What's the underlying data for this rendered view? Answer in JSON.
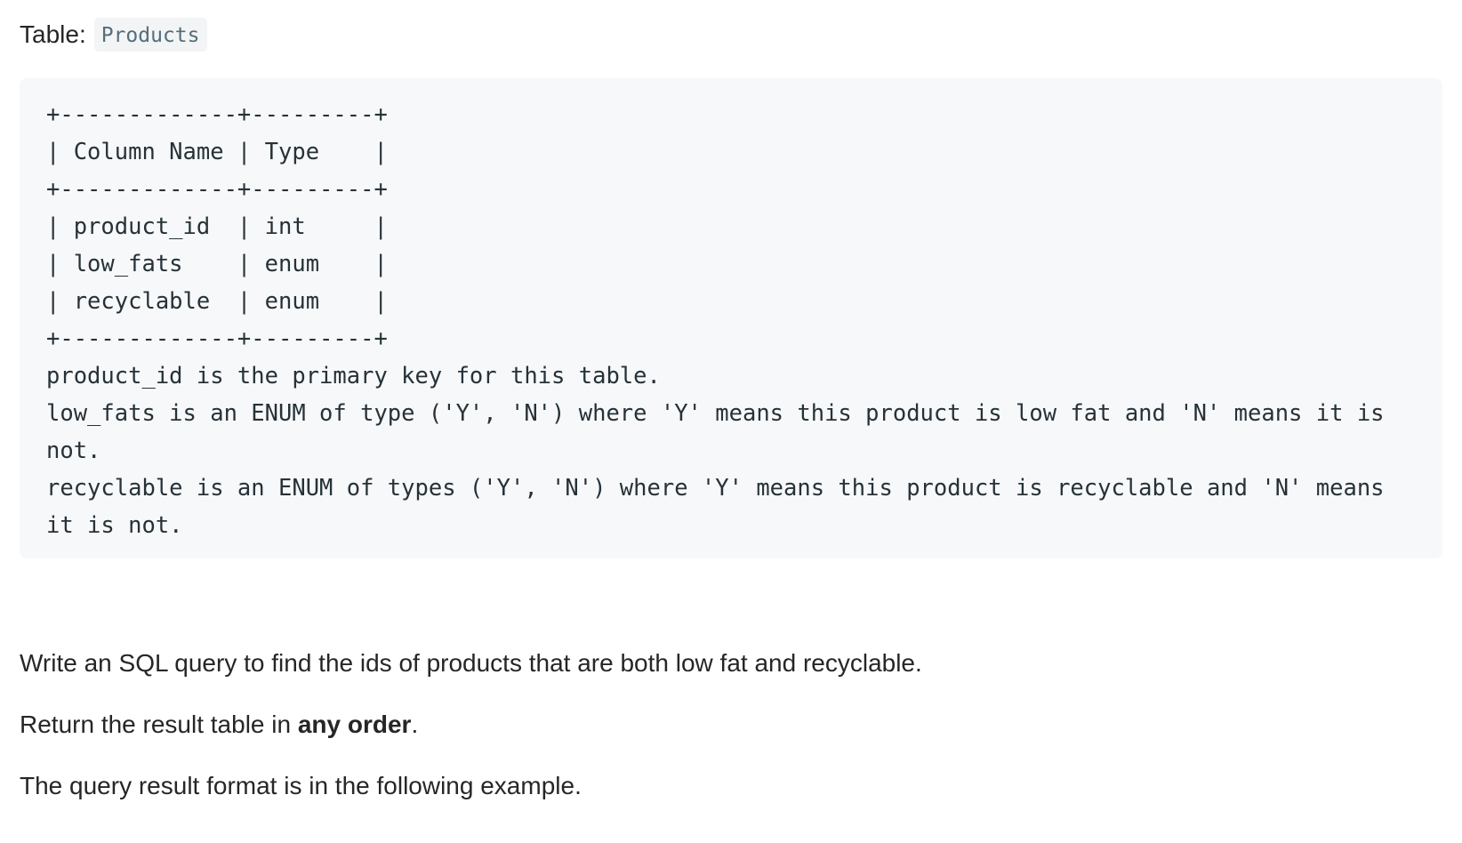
{
  "table_caption": {
    "label": "Table:",
    "table_name": "Products"
  },
  "schema": {
    "lines": [
      "+-------------+---------+",
      "| Column Name | Type    |",
      "+-------------+---------+",
      "| product_id  | int     |",
      "| low_fats    | enum    |",
      "| recyclable  | enum    |",
      "+-------------+---------+"
    ],
    "notes": [
      "product_id is the primary key for this table.",
      "low_fats is an ENUM of type ('Y', 'N') where 'Y' means this product is low fat and 'N' means it is not.",
      "recyclable is an ENUM of types ('Y', 'N') where 'Y' means this product is recyclable and 'N' means it is not."
    ]
  },
  "problem": {
    "statement": "Write an SQL query to find the ids of products that are both low fat and recyclable.",
    "return_prefix": "Return the result table in ",
    "return_bold": "any order",
    "return_suffix": ".",
    "format_note": "The query result format is in the following example."
  }
}
